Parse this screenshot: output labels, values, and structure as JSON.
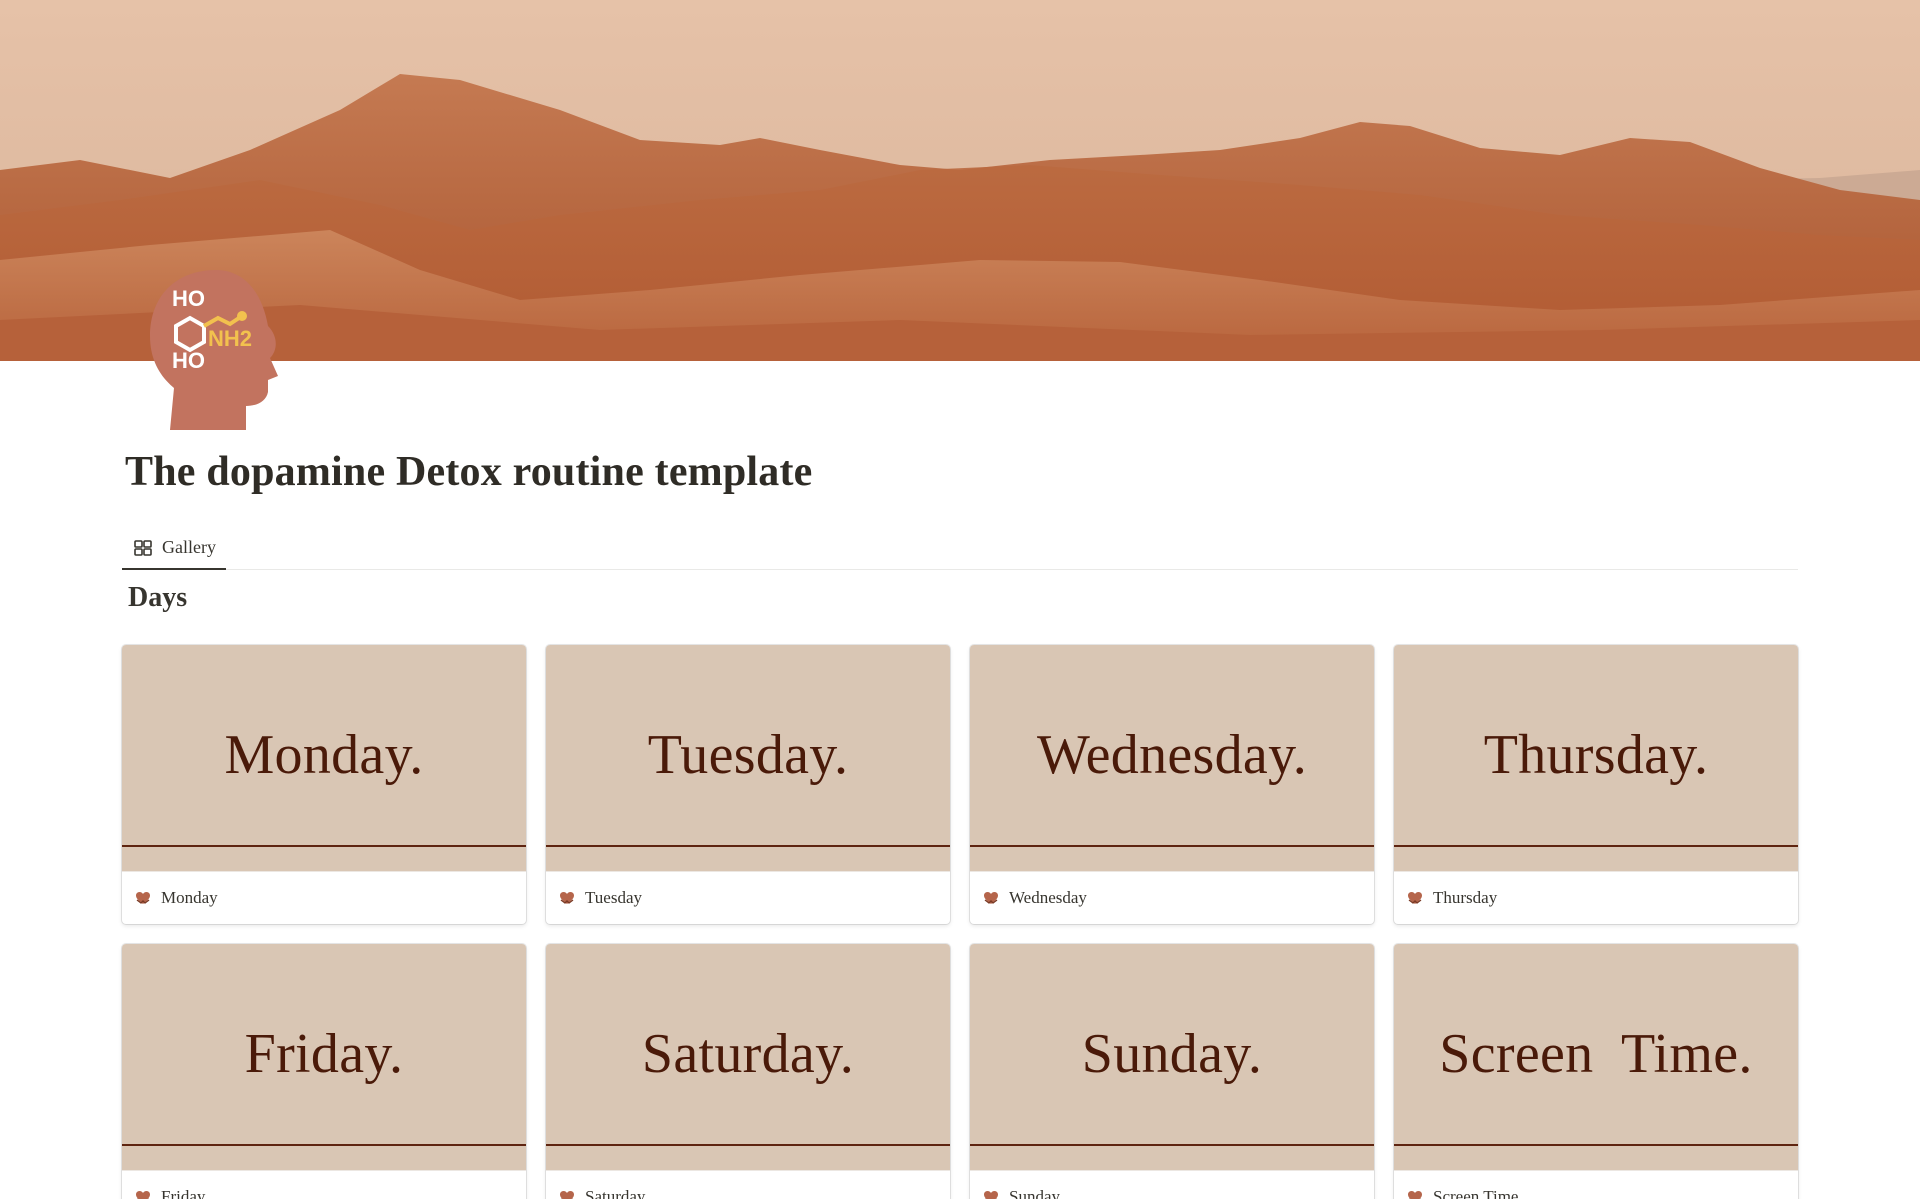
{
  "page": {
    "title": "The dopamine Detox routine template",
    "icon_name": "brain-dopamine-icon",
    "icon_text": {
      "ho_top": "HO",
      "nh2": "NH2",
      "ho_bottom": "HO"
    },
    "cover_name": "desert-dunes-cover"
  },
  "views": [
    {
      "label": "Gallery",
      "icon": "gallery-grid-icon",
      "active": true
    }
  ],
  "section": {
    "title": "Days"
  },
  "cards": [
    {
      "cover_text": "Monday.",
      "label": "Monday",
      "icon": "heart-hands-icon"
    },
    {
      "cover_text": "Tuesday.",
      "label": "Tuesday",
      "icon": "heart-hands-icon"
    },
    {
      "cover_text": "Wednesday.",
      "label": "Wednesday",
      "icon": "heart-hands-icon"
    },
    {
      "cover_text": "Thursday.",
      "label": "Thursday",
      "icon": "heart-hands-icon"
    },
    {
      "cover_text": "Friday.",
      "label": "Friday",
      "icon": "heart-hands-icon"
    },
    {
      "cover_text": "Saturday.",
      "label": "Saturday",
      "icon": "heart-hands-icon"
    },
    {
      "cover_text": "Sunday.",
      "label": "Sunday",
      "icon": "heart-hands-icon"
    },
    {
      "cover_text": "Screen  Time.",
      "label": "Screen Time",
      "icon": "heart-hands-icon"
    }
  ],
  "colors": {
    "card_cover_bg": "#d9c6b4",
    "card_cover_text": "#4a1a09",
    "card_cover_line": "#5e2410",
    "icon_head": "#c2735f",
    "icon_accent": "#f2c14e"
  }
}
